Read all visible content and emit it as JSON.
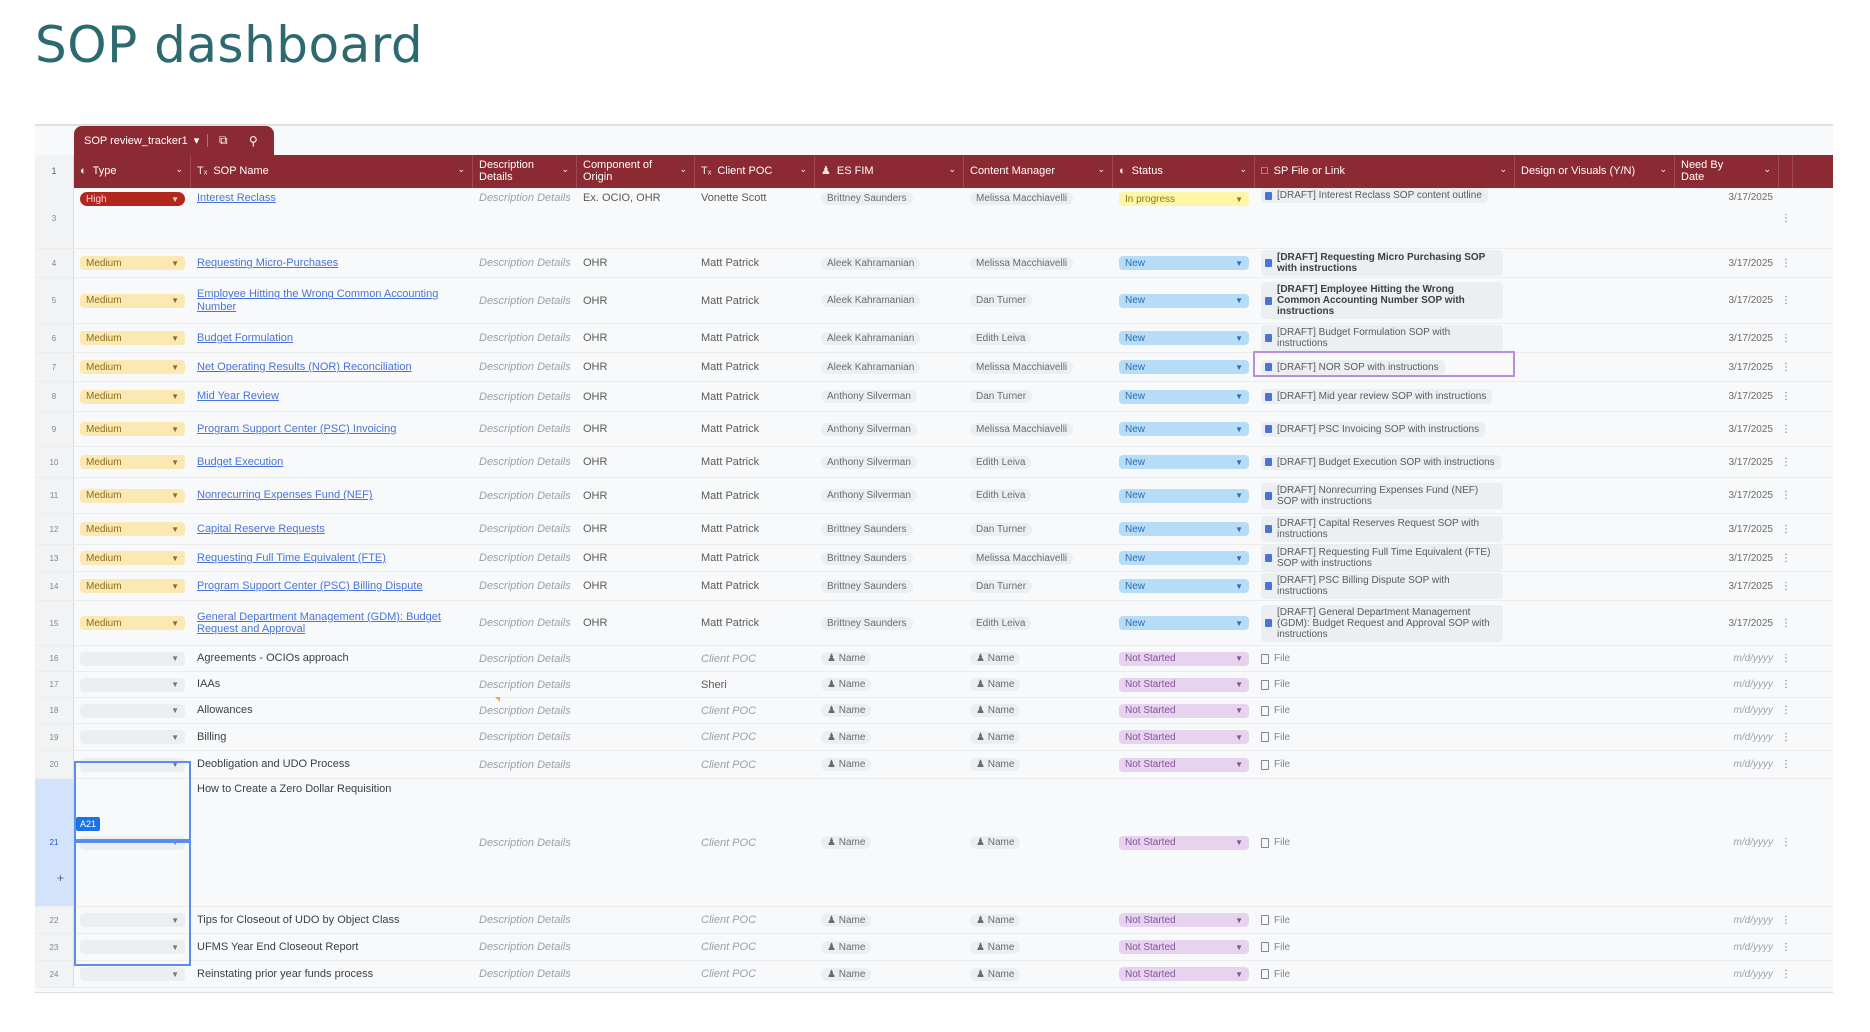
{
  "page": {
    "title": "SOP dashboard"
  },
  "table_tab": {
    "name": "SOP review_tracker1"
  },
  "columns": [
    {
      "label": "Type",
      "icon": "status-icon"
    },
    {
      "label": "SOP Name",
      "icon": "text-icon"
    },
    {
      "label": "Description Details",
      "icon": ""
    },
    {
      "label": "Component of Origin",
      "icon": ""
    },
    {
      "label": "Client POC",
      "icon": "text-icon"
    },
    {
      "label": "ES FIM",
      "icon": "person-icon"
    },
    {
      "label": "Content Manager",
      "icon": ""
    },
    {
      "label": "Status",
      "icon": "status-icon"
    },
    {
      "label": "SP File or Link",
      "icon": "file-icon"
    },
    {
      "label": "Design or Visuals (Y/N)",
      "icon": ""
    },
    {
      "label": "Need By Date",
      "icon": ""
    }
  ],
  "rows": [
    {
      "num": "3",
      "type": "High",
      "name": "Interest Reclass",
      "desc": "Description Details",
      "origin": "Ex. OCIO, OHR",
      "poc": "Vonette Scott",
      "fim": "Brittney Saunders",
      "cm": "Melissa Macchiavelli",
      "status": "In progress",
      "file": "[DRAFT] Interest Reclass SOP content outline",
      "date": "3/17/2025"
    },
    {
      "num": "4",
      "type": "Medium",
      "name": "Requesting Micro-Purchases",
      "desc": "Description Details",
      "origin": "OHR",
      "poc": "Matt Patrick",
      "fim": "Aleek Kahramanian",
      "cm": "Melissa Macchiavelli",
      "status": "New",
      "file": "[DRAFT] Requesting Micro Purchasing SOP with instructions",
      "date": "3/17/2025"
    },
    {
      "num": "5",
      "type": "Medium",
      "name": "Employee Hitting the Wrong Common Accounting Number",
      "desc": "Description Details",
      "origin": "OHR",
      "poc": "Matt Patrick",
      "fim": "Aleek Kahramanian",
      "cm": "Dan Turner",
      "status": "New",
      "file": "[DRAFT] Employee Hitting the Wrong Common Accounting Number SOP with instructions",
      "date": "3/17/2025"
    },
    {
      "num": "6",
      "type": "Medium",
      "name": "Budget Formulation",
      "desc": "Description Details",
      "origin": "OHR",
      "poc": "Matt Patrick",
      "fim": "Aleek Kahramanian",
      "cm": "Edith Leiva",
      "status": "New",
      "file": "[DRAFT] Budget Formulation SOP with instructions",
      "date": "3/17/2025"
    },
    {
      "num": "7",
      "type": "Medium",
      "name": "Net Operating Results (NOR) Reconciliation",
      "desc": "Description Details",
      "origin": "OHR",
      "poc": "Matt Patrick",
      "fim": "Aleek Kahramanian",
      "cm": "Melissa Macchiavelli",
      "status": "New",
      "file": "[DRAFT] NOR SOP with instructions",
      "date": "3/17/2025"
    },
    {
      "num": "8",
      "type": "Medium",
      "name": "Mid Year Review",
      "desc": "Description Details",
      "origin": "OHR",
      "poc": "Matt Patrick",
      "fim": "Anthony Silverman",
      "cm": "Dan Turner",
      "status": "New",
      "file": "[DRAFT] Mid year review SOP with instructions",
      "date": "3/17/2025"
    },
    {
      "num": "9",
      "type": "Medium",
      "name": "Program Support Center (PSC) Invoicing",
      "desc": "Description Details",
      "origin": "OHR",
      "poc": "Matt Patrick",
      "fim": "Anthony Silverman",
      "cm": "Melissa Macchiavelli",
      "status": "New",
      "file": "[DRAFT] PSC Invoicing SOP with instructions",
      "date": "3/17/2025"
    },
    {
      "num": "10",
      "type": "Medium",
      "name": "Budget Execution",
      "desc": "Description Details",
      "origin": "OHR",
      "poc": "Matt Patrick",
      "fim": "Anthony Silverman",
      "cm": "Edith Leiva",
      "status": "New",
      "file": "[DRAFT] Budget Execution SOP with instructions",
      "date": "3/17/2025"
    },
    {
      "num": "11",
      "type": "Medium",
      "name": "Nonrecurring Expenses Fund (NEF)",
      "desc": "Description Details",
      "origin": "OHR",
      "poc": "Matt Patrick",
      "fim": "Anthony Silverman",
      "cm": "Edith Leiva",
      "status": "New",
      "file": "[DRAFT] Nonrecurring Expenses Fund (NEF) SOP with instructions",
      "date": "3/17/2025"
    },
    {
      "num": "12",
      "type": "Medium",
      "name": "Capital Reserve Requests",
      "desc": "Description Details",
      "origin": "OHR",
      "poc": "Matt Patrick",
      "fim": "Brittney Saunders",
      "cm": "Dan Turner",
      "status": "New",
      "file": "[DRAFT] Capital Reserves Request SOP with instructions",
      "date": "3/17/2025"
    },
    {
      "num": "13",
      "type": "Medium",
      "name": "Requesting Full Time Equivalent (FTE)",
      "desc": "Description Details",
      "origin": "OHR",
      "poc": "Matt Patrick",
      "fim": "Brittney Saunders",
      "cm": "Melissa Macchiavelli",
      "status": "New",
      "file": "[DRAFT] Requesting Full Time Equivalent (FTE) SOP with instructions",
      "date": "3/17/2025"
    },
    {
      "num": "14",
      "type": "Medium",
      "name": "Program Support Center (PSC) Billing Dispute",
      "desc": "Description Details",
      "origin": "OHR",
      "poc": "Matt Patrick",
      "fim": "Brittney Saunders",
      "cm": "Dan Turner",
      "status": "New",
      "file": "[DRAFT] PSC Billing Dispute SOP with instructions",
      "date": "3/17/2025"
    },
    {
      "num": "15",
      "type": "Medium",
      "name": "General Department Management (GDM): Budget Request and Approval",
      "desc": "Description Details",
      "origin": "OHR",
      "poc": "Matt Patrick",
      "fim": "Brittney Saunders",
      "cm": "Edith Leiva",
      "status": "New",
      "file": "[DRAFT] General Department Management (GDM): Budget Request and Approval SOP with instructions",
      "date": "3/17/2025"
    },
    {
      "num": "16",
      "type": "",
      "name": "Agreements - OCIOs approach",
      "desc": "Description Details",
      "origin": "",
      "poc": "Client POC",
      "fim": "Name",
      "cm": "Name",
      "status": "Not Started",
      "file": "File",
      "date": "m/d/yyyy"
    },
    {
      "num": "17",
      "type": "",
      "name": "IAAs",
      "desc": "Description Details",
      "origin": "",
      "poc": "Sheri",
      "fim": "Name",
      "cm": "Name",
      "status": "Not Started",
      "file": "File",
      "date": "m/d/yyyy"
    },
    {
      "num": "18",
      "type": "",
      "name": "Allowances",
      "desc": "Description Details",
      "origin": "",
      "poc": "Client POC",
      "fim": "Name",
      "cm": "Name",
      "status": "Not Started",
      "file": "File",
      "date": "m/d/yyyy"
    },
    {
      "num": "19",
      "type": "",
      "name": "Billing",
      "desc": "Description Details",
      "origin": "",
      "poc": "Client POC",
      "fim": "Name",
      "cm": "Name",
      "status": "Not Started",
      "file": "File",
      "date": "m/d/yyyy"
    },
    {
      "num": "20",
      "type": "",
      "name": "Deobligation and UDO Process",
      "desc": "Description Details",
      "origin": "",
      "poc": "Client POC",
      "fim": "Name",
      "cm": "Name",
      "status": "Not Started",
      "file": "File",
      "date": "m/d/yyyy"
    },
    {
      "num": "21",
      "type": "",
      "name": "How to Create a Zero Dollar Requisition",
      "desc": "Description Details",
      "origin": "",
      "poc": "Client POC",
      "fim": "Name",
      "cm": "Name",
      "status": "Not Started",
      "file": "File",
      "date": "m/d/yyyy"
    },
    {
      "num": "22",
      "type": "",
      "name": "Tips for Closeout of UDO by Object Class",
      "desc": "Description Details",
      "origin": "",
      "poc": "Client POC",
      "fim": "Name",
      "cm": "Name",
      "status": "Not Started",
      "file": "File",
      "date": "m/d/yyyy"
    },
    {
      "num": "23",
      "type": "",
      "name": "UFMS Year End Closeout Report",
      "desc": "Description Details",
      "origin": "",
      "poc": "Client POC",
      "fim": "Name",
      "cm": "Name",
      "status": "Not Started",
      "file": "File",
      "date": "m/d/yyyy"
    },
    {
      "num": "24",
      "type": "",
      "name": "Reinstating prior year funds process",
      "desc": "Description Details",
      "origin": "",
      "poc": "Client POC",
      "fim": "Name",
      "cm": "Name",
      "status": "Not Started",
      "file": "File",
      "date": "m/d/yyyy"
    }
  ],
  "selection": {
    "cell_ref": "A21",
    "selected_row": "21"
  },
  "highlighted_file_row": "7"
}
